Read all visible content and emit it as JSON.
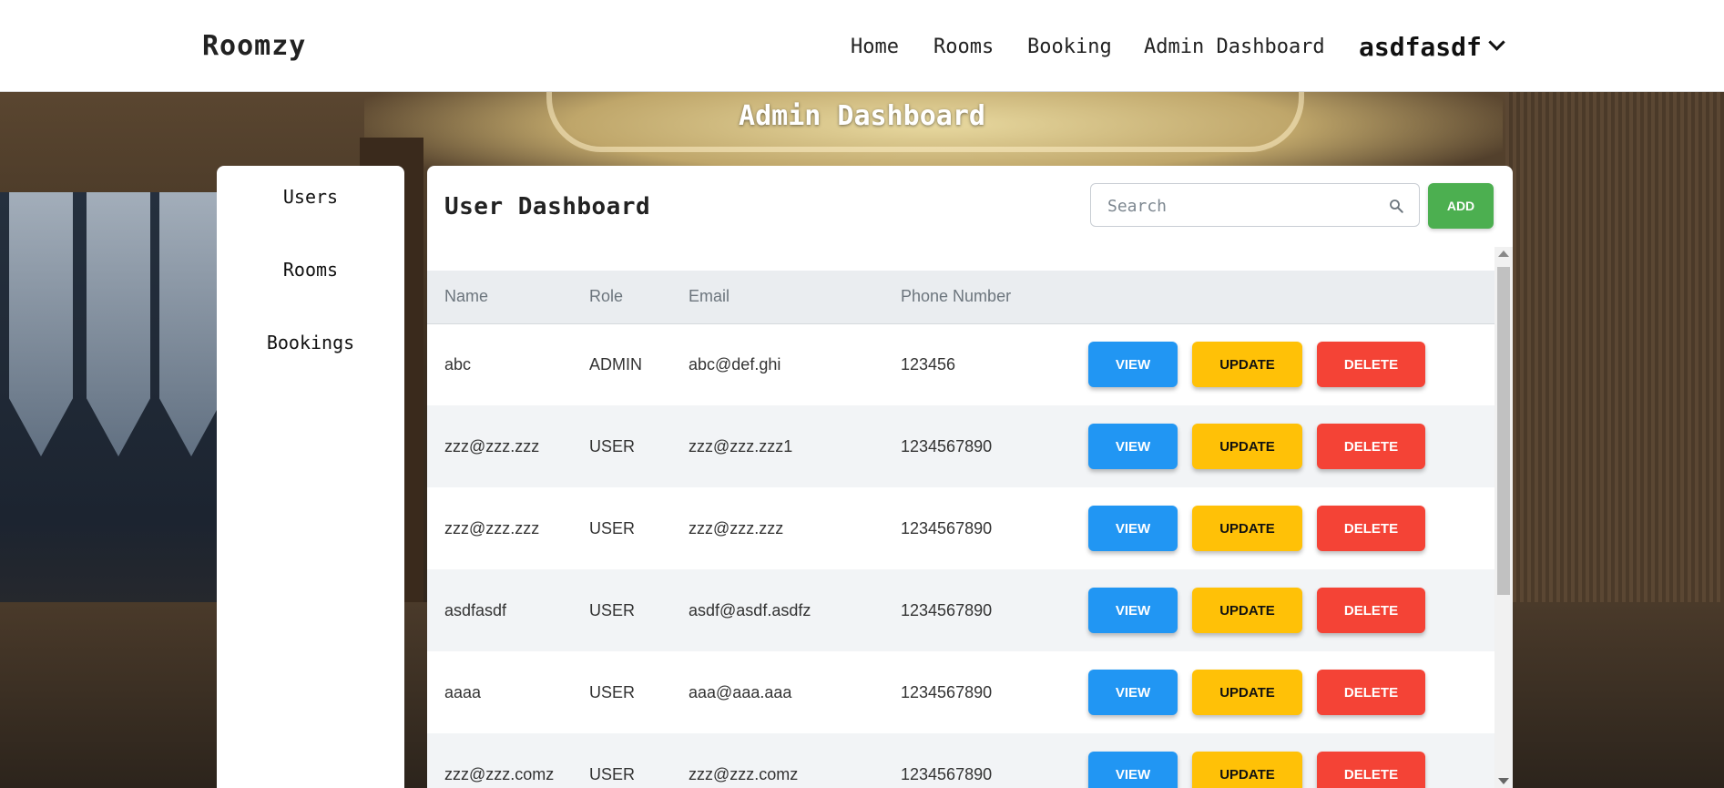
{
  "navbar": {
    "brand": "Roomzy",
    "links": [
      "Home",
      "Rooms",
      "Booking",
      "Admin Dashboard"
    ],
    "user": "asdfasdf"
  },
  "page_title": "Admin Dashboard",
  "sidebar": {
    "items": [
      "Users",
      "Rooms",
      "Bookings"
    ]
  },
  "panel": {
    "title": "User Dashboard",
    "search_placeholder": "Search",
    "add_label": "ADD"
  },
  "table": {
    "columns": [
      "Name",
      "Role",
      "Email",
      "Phone Number"
    ],
    "rows": [
      {
        "name": "abc",
        "role": "ADMIN",
        "email": "abc@def.ghi",
        "phone": "123456"
      },
      {
        "name": "zzz@zzz.zzz",
        "role": "USER",
        "email": "zzz@zzz.zzz1",
        "phone": "1234567890"
      },
      {
        "name": "zzz@zzz.zzz",
        "role": "USER",
        "email": "zzz@zzz.zzz",
        "phone": "1234567890"
      },
      {
        "name": "asdfasdf",
        "role": "USER",
        "email": "asdf@asdf.asdfz",
        "phone": "1234567890"
      },
      {
        "name": "aaaa",
        "role": "USER",
        "email": "aaa@aaa.aaa",
        "phone": "1234567890"
      },
      {
        "name": "zzz@zzz.comz",
        "role": "USER",
        "email": "zzz@zzz.comz",
        "phone": "1234567890"
      }
    ],
    "actions": {
      "view": "VIEW",
      "update": "UPDATE",
      "delete": "DELETE"
    }
  },
  "colors": {
    "add": "#4caf50",
    "view": "#2196f3",
    "update": "#ffc107",
    "delete": "#f44336"
  }
}
